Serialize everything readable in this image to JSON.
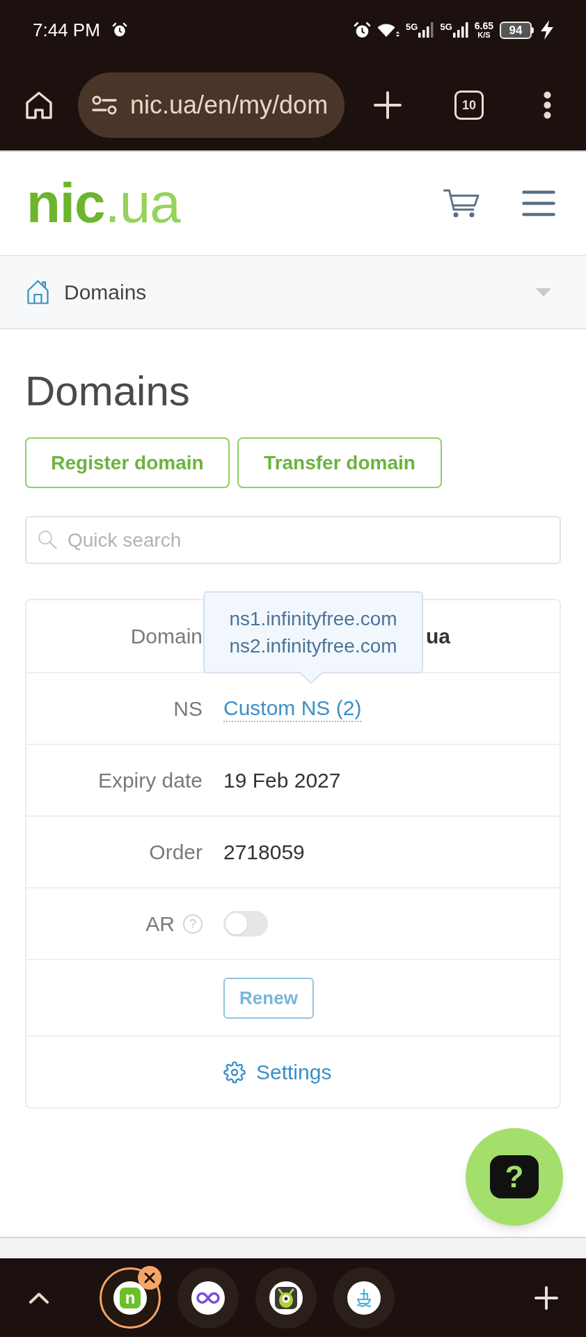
{
  "status_bar": {
    "time": "7:44 PM",
    "networks": [
      "5G",
      "5G"
    ],
    "speed": "6.65",
    "speed_unit": "K/S",
    "battery": "94"
  },
  "browser_toolbar": {
    "url": "nic.ua/en/my/dom",
    "tab_count": "10"
  },
  "header": {
    "logo": {
      "name": "nic",
      "suffix": ".ua"
    }
  },
  "breadcrumb": {
    "label": "Domains"
  },
  "page": {
    "title": "Domains",
    "buttons": [
      "Register domain",
      "Transfer domain"
    ],
    "search": {
      "placeholder": "Quick search"
    }
  },
  "domain_card": {
    "rows": [
      {
        "kind": "domain",
        "label": "Domain",
        "value": "ua"
      },
      {
        "kind": "link",
        "label": "NS",
        "value": "Custom NS (2)"
      },
      {
        "kind": "text",
        "label": "Expiry date",
        "value": "19 Feb 2027"
      },
      {
        "kind": "text",
        "label": "Order",
        "value": "2718059"
      },
      {
        "kind": "toggle",
        "label": "AR",
        "hint": "?",
        "on": false
      },
      {
        "kind": "button",
        "label": "Renew"
      },
      {
        "kind": "action",
        "label": "Settings"
      }
    ],
    "tooltip": {
      "lines": [
        "ns1.infinityfree.com",
        "ns2.infinityfree.com"
      ]
    }
  },
  "help_button": {
    "label": "?"
  },
  "bottom_bar": {
    "tab_groups": [
      {
        "selected": true,
        "favicon_text": "n"
      },
      {
        "selected": false
      },
      {
        "selected": false
      },
      {
        "selected": false
      }
    ]
  }
}
